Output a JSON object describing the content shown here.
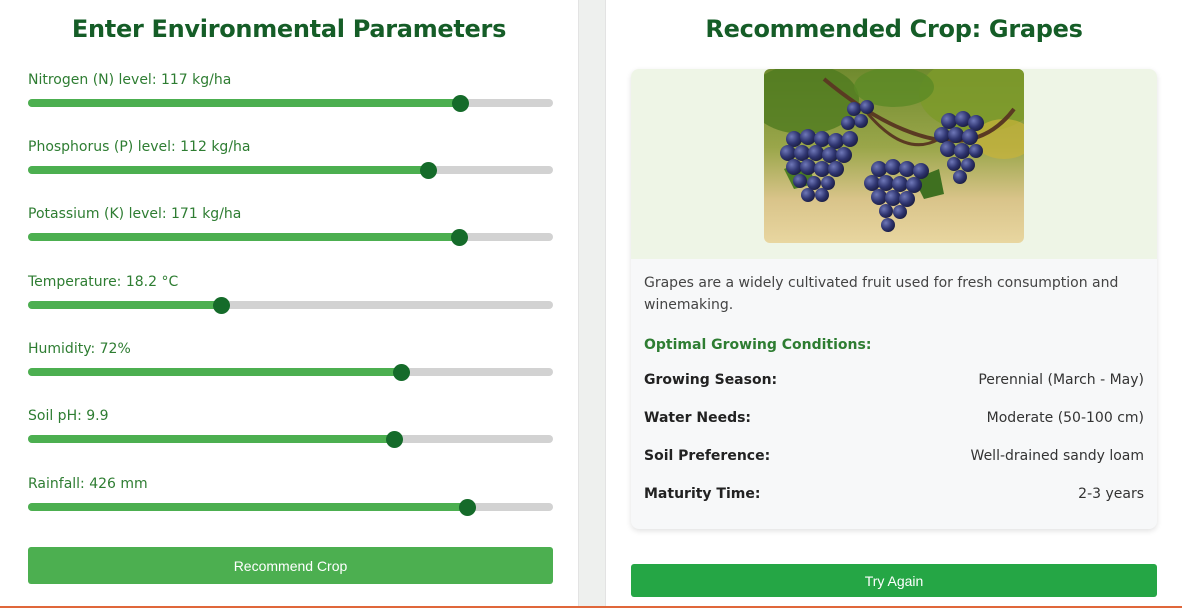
{
  "left": {
    "title": "Enter Environmental Parameters",
    "params": [
      {
        "label": "Nitrogen (N) level: 117 kg/ha",
        "fraction": 0.822
      },
      {
        "label": "Phosphorus (P) level: 112 kg/ha",
        "fraction": 0.762
      },
      {
        "label": "Potassium (K) level: 171 kg/ha",
        "fraction": 0.821
      },
      {
        "label": "Temperature: 18.2 °C",
        "fraction": 0.368
      },
      {
        "label": "Humidity: 72%",
        "fraction": 0.711
      },
      {
        "label": "Soil pH: 9.9",
        "fraction": 0.698
      },
      {
        "label": "Rainfall: 426 mm",
        "fraction": 0.837
      }
    ],
    "button": "Recommend Crop"
  },
  "right": {
    "title": "Recommended Crop: Grapes",
    "description": "Grapes are a widely cultivated fruit used for fresh consumption and winemaking.",
    "conditions_heading": "Optimal Growing Conditions:",
    "conditions": [
      {
        "key": "Growing Season:",
        "value": "Perennial (March - May)"
      },
      {
        "key": "Water Needs:",
        "value": "Moderate (50-100 cm)"
      },
      {
        "key": "Soil Preference:",
        "value": "Well-drained sandy loam"
      },
      {
        "key": "Maturity Time:",
        "value": "2-3 years"
      }
    ],
    "button": "Try Again"
  },
  "colors": {
    "heading": "#155d27",
    "label": "#2e7d32",
    "slider_fill": "#4caf50",
    "slider_thumb": "#156b2a",
    "slider_track": "#d2d2d2",
    "recommend_button": "#4caf50",
    "try_button": "#25a645"
  }
}
